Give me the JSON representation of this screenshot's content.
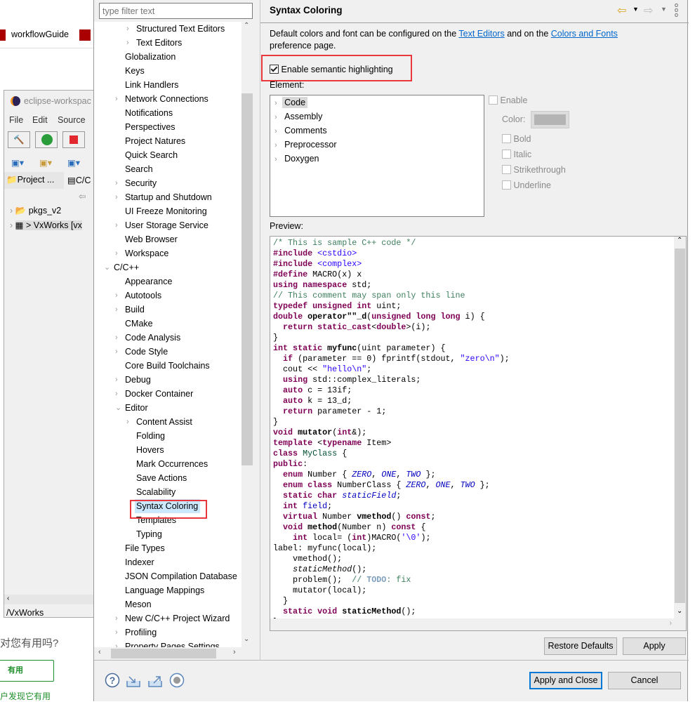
{
  "background": {
    "tab_label": "workflowGuide",
    "eclipse_title": "eclipse-workspac",
    "menu": [
      "File",
      "Edit",
      "Source"
    ],
    "view_tabs": [
      "Project ...",
      "C/C"
    ],
    "project_items": [
      "pkgs_v2",
      "> VxWorks [vx"
    ],
    "status_path": "/VxWorks",
    "feedback_question": "对您有用吗?",
    "useful_button": "有用",
    "found_useful": "户发现它有用"
  },
  "filter": {
    "placeholder": "type filter text"
  },
  "tree": [
    {
      "label": "Structured Text Editors",
      "level": 2,
      "arrow": "right"
    },
    {
      "label": "Text Editors",
      "level": 2,
      "arrow": "right"
    },
    {
      "label": "Globalization",
      "level": 1
    },
    {
      "label": "Keys",
      "level": 1
    },
    {
      "label": "Link Handlers",
      "level": 1
    },
    {
      "label": "Network Connections",
      "level": 1,
      "arrow": "right"
    },
    {
      "label": "Notifications",
      "level": 1
    },
    {
      "label": "Perspectives",
      "level": 1
    },
    {
      "label": "Project Natures",
      "level": 1
    },
    {
      "label": "Quick Search",
      "level": 1
    },
    {
      "label": "Search",
      "level": 1
    },
    {
      "label": "Security",
      "level": 1,
      "arrow": "right"
    },
    {
      "label": "Startup and Shutdown",
      "level": 1,
      "arrow": "right"
    },
    {
      "label": "UI Freeze Monitoring",
      "level": 1
    },
    {
      "label": "User Storage Service",
      "level": 1,
      "arrow": "right"
    },
    {
      "label": "Web Browser",
      "level": 1
    },
    {
      "label": "Workspace",
      "level": 1,
      "arrow": "right"
    },
    {
      "label": "C/C++",
      "level": 0,
      "arrow": "down"
    },
    {
      "label": "Appearance",
      "level": 1
    },
    {
      "label": "Autotools",
      "level": 1,
      "arrow": "right"
    },
    {
      "label": "Build",
      "level": 1,
      "arrow": "right"
    },
    {
      "label": "CMake",
      "level": 1
    },
    {
      "label": "Code Analysis",
      "level": 1,
      "arrow": "right"
    },
    {
      "label": "Code Style",
      "level": 1,
      "arrow": "right"
    },
    {
      "label": "Core Build Toolchains",
      "level": 1
    },
    {
      "label": "Debug",
      "level": 1,
      "arrow": "right"
    },
    {
      "label": "Docker Container",
      "level": 1,
      "arrow": "right"
    },
    {
      "label": "Editor",
      "level": 1,
      "arrow": "down"
    },
    {
      "label": "Content Assist",
      "level": 2,
      "arrow": "right"
    },
    {
      "label": "Folding",
      "level": 2
    },
    {
      "label": "Hovers",
      "level": 2
    },
    {
      "label": "Mark Occurrences",
      "level": 2
    },
    {
      "label": "Save Actions",
      "level": 2
    },
    {
      "label": "Scalability",
      "level": 2
    },
    {
      "label": "Syntax Coloring",
      "level": 2,
      "selected": true
    },
    {
      "label": "Templates",
      "level": 2
    },
    {
      "label": "Typing",
      "level": 2
    },
    {
      "label": "File Types",
      "level": 1
    },
    {
      "label": "Indexer",
      "level": 1
    },
    {
      "label": "JSON Compilation Database",
      "level": 1
    },
    {
      "label": "Language Mappings",
      "level": 1
    },
    {
      "label": "Meson",
      "level": 1
    },
    {
      "label": "New C/C++ Project Wizard",
      "level": 1,
      "arrow": "right"
    },
    {
      "label": "Profiling",
      "level": 1,
      "arrow": "right"
    },
    {
      "label": "Property Pages Settings",
      "level": 1,
      "arrow": "right"
    }
  ],
  "page": {
    "title": "Syntax Coloring",
    "desc_1": "Default colors and font can be configured on the ",
    "link_text_editors": "Text Editors",
    "desc_2": " and on the ",
    "link_colors_fonts": "Colors and Fonts",
    "desc_3": "preference page.",
    "semantic_label": "Enable semantic highlighting",
    "semantic_checked": true,
    "element_label": "Element:",
    "elements": [
      "Code",
      "Assembly",
      "Comments",
      "Preprocessor",
      "Doxygen"
    ],
    "enable_label": "Enable",
    "color_label": "Color:",
    "color_swatch": "#b4b4b4",
    "style_options": [
      "Bold",
      "Italic",
      "Strikethrough",
      "Underline"
    ],
    "preview_label": "Preview:"
  },
  "preview_code": [
    [
      [
        "/* This is sample C++ code */",
        "c"
      ]
    ],
    [
      [
        "#include",
        "k"
      ],
      [
        " "
      ],
      [
        "<cstdio>",
        "s"
      ]
    ],
    [
      [
        "#include",
        "k"
      ],
      [
        " "
      ],
      [
        "<complex>",
        "s"
      ]
    ],
    [
      [
        "#define",
        "k"
      ],
      [
        " MACRO(x) x"
      ]
    ],
    [
      [
        "using namespace",
        "k"
      ],
      [
        " std;"
      ]
    ],
    [
      [
        "// This comment may span only this line",
        "c"
      ]
    ],
    [
      [
        "typedef unsigned int",
        "k"
      ],
      [
        " uint;"
      ]
    ],
    [
      [
        "double",
        "k"
      ],
      [
        " "
      ],
      [
        "operator\"\"_d",
        "f"
      ],
      [
        "("
      ],
      [
        "unsigned long long",
        "k"
      ],
      [
        " i) {"
      ]
    ],
    [
      [
        "  "
      ],
      [
        "return static_cast",
        "k"
      ],
      [
        "<"
      ],
      [
        "double",
        "k"
      ],
      [
        ">(i);"
      ]
    ],
    [
      [
        "}"
      ]
    ],
    [
      [
        "int static",
        "k"
      ],
      [
        " "
      ],
      [
        "myfunc",
        "f"
      ],
      [
        "(uint parameter) {"
      ]
    ],
    [
      [
        "  "
      ],
      [
        "if",
        "k"
      ],
      [
        " (parameter == 0) fprintf(stdout, "
      ],
      [
        "\"zero\\n\"",
        "s"
      ],
      [
        ");"
      ]
    ],
    [
      [
        "  cout << "
      ],
      [
        "\"hello\\n\"",
        "s"
      ],
      [
        ";"
      ]
    ],
    [
      [
        "  "
      ],
      [
        "using",
        "k"
      ],
      [
        " std::complex_literals;"
      ]
    ],
    [
      [
        "  "
      ],
      [
        "auto",
        "k"
      ],
      [
        " c = 13if;"
      ]
    ],
    [
      [
        "  "
      ],
      [
        "auto",
        "k"
      ],
      [
        " k = 13_d;"
      ]
    ],
    [
      [
        "  "
      ],
      [
        "return",
        "k"
      ],
      [
        " parameter - 1;"
      ]
    ],
    [
      [
        "}"
      ]
    ],
    [
      [
        "void",
        "k"
      ],
      [
        " "
      ],
      [
        "mutator",
        "f"
      ],
      [
        "("
      ],
      [
        "int",
        "k"
      ],
      [
        "&);"
      ]
    ],
    [
      [
        "template",
        "k"
      ],
      [
        " <"
      ],
      [
        "typename",
        "k"
      ],
      [
        " Item>"
      ]
    ],
    [
      [
        "class",
        "k"
      ],
      [
        " "
      ],
      [
        "MyClass",
        "t"
      ],
      [
        " {"
      ]
    ],
    [
      [
        "public",
        "k"
      ],
      [
        ":"
      ]
    ],
    [
      [
        "  "
      ],
      [
        "enum",
        "k"
      ],
      [
        " Number { "
      ],
      [
        "ZERO",
        "e"
      ],
      [
        ", "
      ],
      [
        "ONE",
        "e"
      ],
      [
        ", "
      ],
      [
        "TWO",
        "e"
      ],
      [
        " };"
      ]
    ],
    [
      [
        "  "
      ],
      [
        "enum class",
        "k"
      ],
      [
        " NumberClass { "
      ],
      [
        "ZERO",
        "e"
      ],
      [
        ", "
      ],
      [
        "ONE",
        "e"
      ],
      [
        ", "
      ],
      [
        "TWO",
        "e"
      ],
      [
        " };"
      ]
    ],
    [
      [
        "  "
      ],
      [
        "static char",
        "k"
      ],
      [
        " "
      ],
      [
        "staticField",
        "e"
      ],
      [
        ";"
      ]
    ],
    [
      [
        "  "
      ],
      [
        "int",
        "k"
      ],
      [
        " "
      ],
      [
        "field",
        "fd"
      ],
      [
        ";"
      ]
    ],
    [
      [
        "  "
      ],
      [
        "virtual",
        "k"
      ],
      [
        " Number "
      ],
      [
        "vmethod",
        "f"
      ],
      [
        "() "
      ],
      [
        "const",
        "k"
      ],
      [
        ";"
      ]
    ],
    [
      [
        "  "
      ],
      [
        "void",
        "k"
      ],
      [
        " "
      ],
      [
        "method",
        "f"
      ],
      [
        "(Number n) "
      ],
      [
        "const",
        "k"
      ],
      [
        " {"
      ]
    ],
    [
      [
        "    "
      ],
      [
        "int",
        "k"
      ],
      [
        " local= ("
      ],
      [
        "int",
        "k"
      ],
      [
        ")MACRO("
      ],
      [
        "'\\0'",
        "s"
      ],
      [
        ");"
      ]
    ],
    [
      [
        "label: myfunc(local);"
      ]
    ],
    [
      [
        "    vmethod();"
      ]
    ],
    [
      [
        "    "
      ],
      [
        "staticMethod",
        "i"
      ],
      [
        "();"
      ]
    ],
    [
      [
        "    problem();  "
      ],
      [
        "// ",
        "c"
      ],
      [
        "TODO",
        "td"
      ],
      [
        ": fix",
        "c"
      ]
    ],
    [
      [
        "    mutator(local);"
      ]
    ],
    [
      [
        "  }"
      ]
    ],
    [
      [
        "  "
      ],
      [
        "static void",
        "k"
      ],
      [
        " "
      ],
      [
        "staticMethod",
        "f"
      ],
      [
        "();"
      ]
    ],
    [
      [
        "}"
      ]
    ]
  ],
  "buttons": {
    "restore_defaults": "Restore Defaults",
    "apply": "Apply",
    "apply_and_close": "Apply and Close",
    "cancel": "Cancel"
  },
  "colors": {
    "accent": "#0078d7",
    "highlight_box": "#e8383d",
    "link": "#0066cc",
    "selection": "#cce8ff"
  }
}
